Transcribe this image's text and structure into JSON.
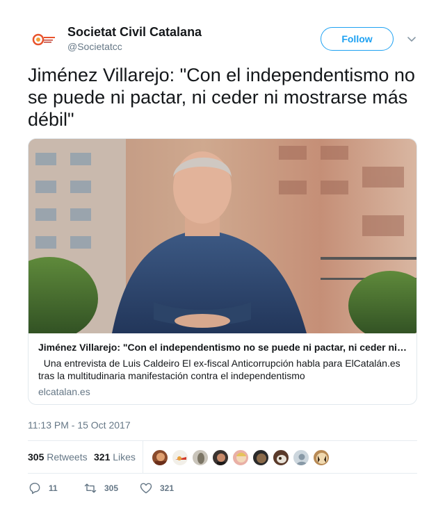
{
  "account": {
    "name": "Societat Civil Catalana",
    "handle": "@Societatcc",
    "avatar_icon": "societat-civil-catalana-logo"
  },
  "follow_label": "Follow",
  "tweet": {
    "text": "Jiménez Villarejo: \"Con el independentismo no se puede ni pactar, ni ceder ni mostrarse más débil\"",
    "timestamp": "11:13 PM - 15 Oct 2017"
  },
  "card": {
    "title": "Jiménez Villarejo: \"Con el independentismo no se puede ni pactar, ni ceder ni mostrarse más débil\"",
    "description": "  Una entrevista de Luis Caldeiro El ex-fiscal Anticorrupción habla para ElCatalán.es tras la multitudinaria manifestación contra el independentismo",
    "domain": "elcatalan.es",
    "image_icon": "man-portrait-photo"
  },
  "stats": {
    "retweets_count": "305",
    "retweets_label": "Retweets",
    "likes_count": "321",
    "likes_label": "Likes"
  },
  "actions": {
    "reply_count": "11",
    "retweet_count": "305",
    "like_count": "321"
  },
  "colors": {
    "accent": "#1da1f2",
    "text": "#14171a",
    "muted": "#657786",
    "border": "#e1e8ed"
  }
}
